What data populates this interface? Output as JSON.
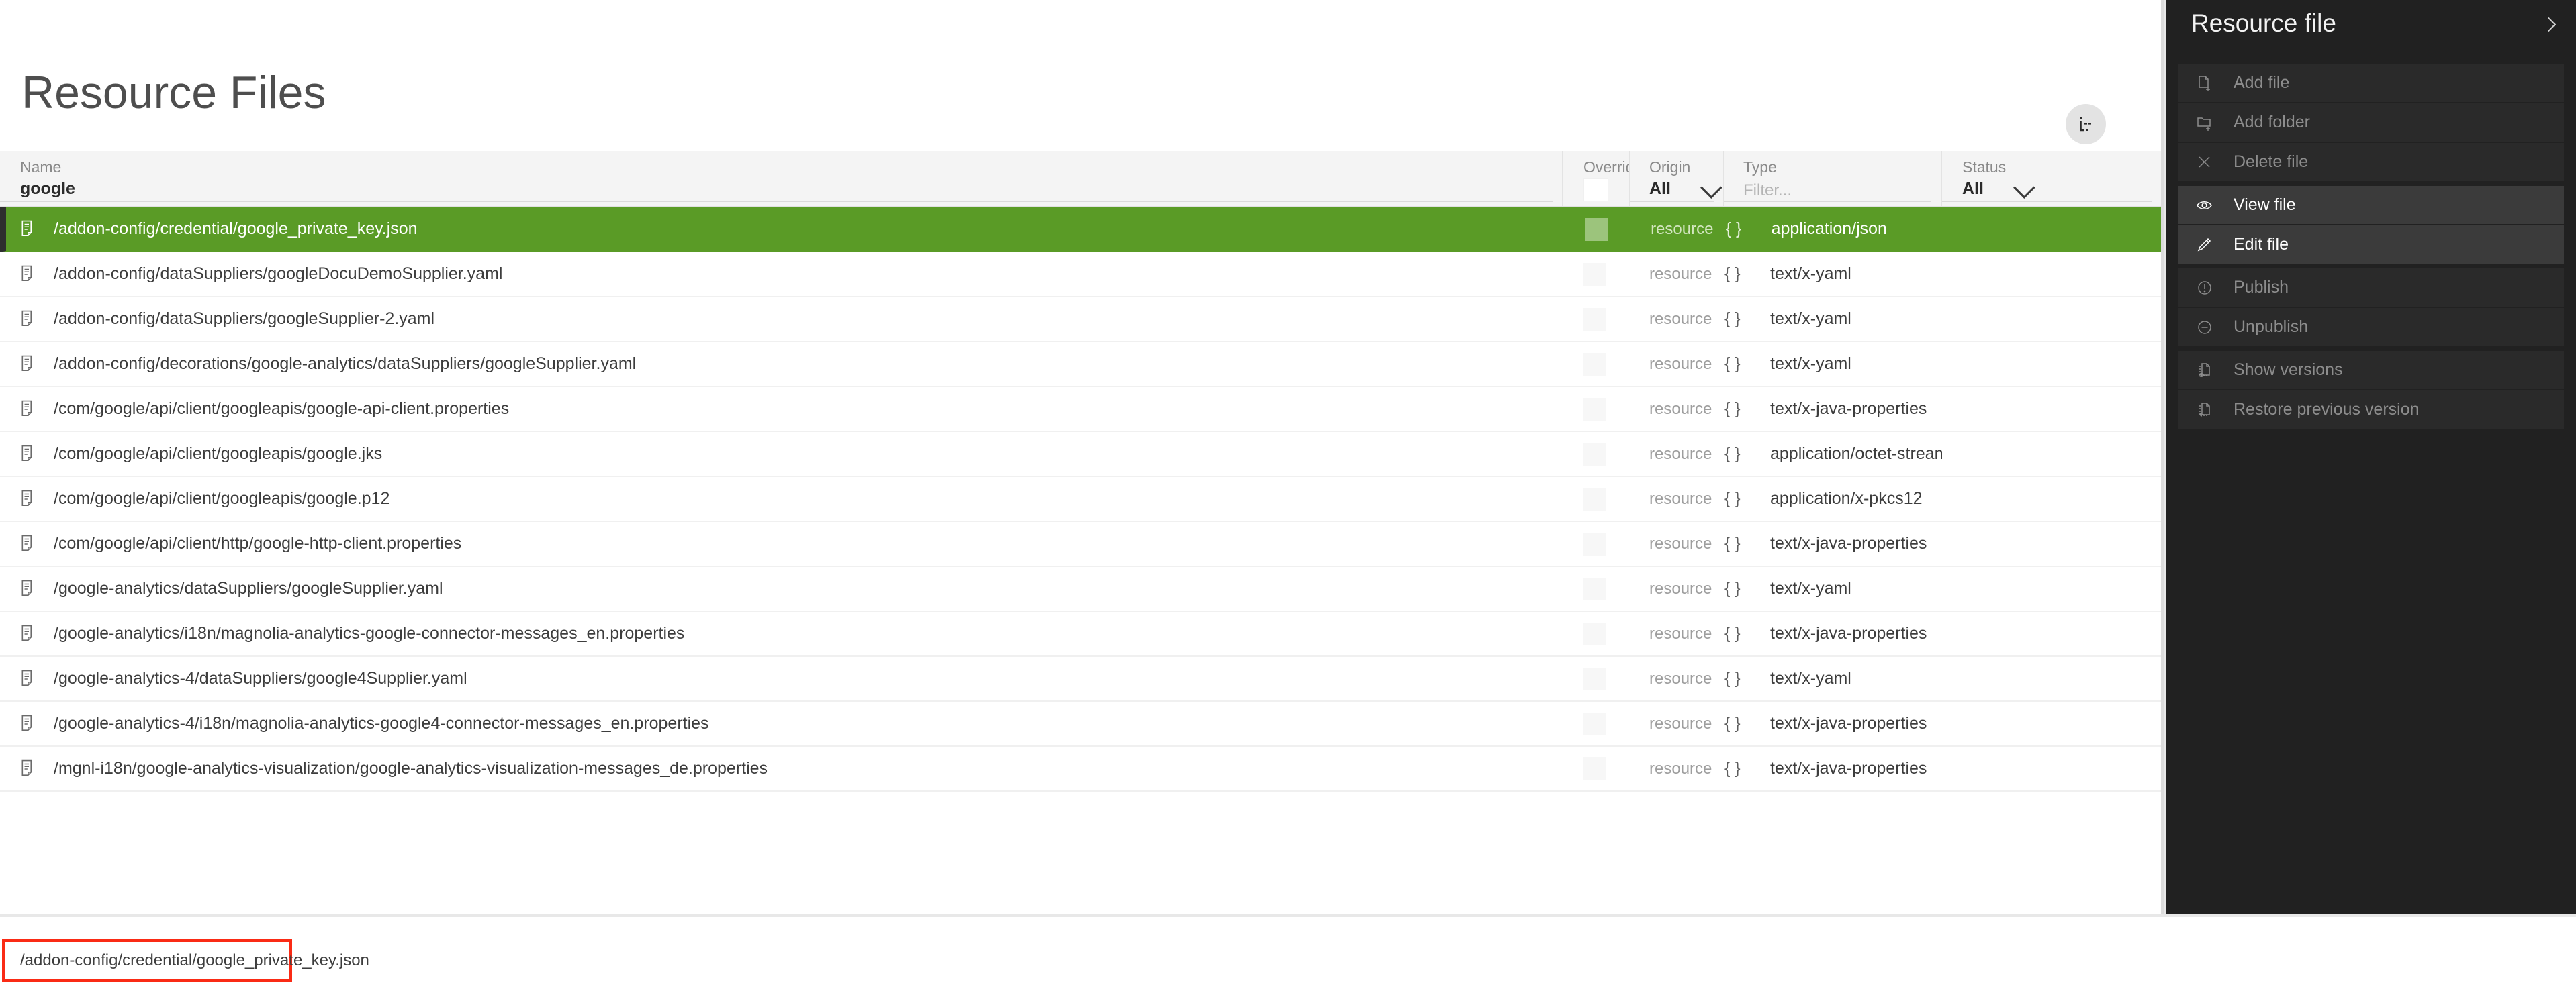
{
  "page": {
    "title": "Resource Files",
    "view_toggle_icon": "tree-view-icon"
  },
  "table": {
    "columns": [
      {
        "key": "name",
        "label": "Name",
        "filter_value": "google",
        "filter_type": "text"
      },
      {
        "key": "overrides",
        "label": "Overrides ?",
        "filter_value": "",
        "filter_type": "box"
      },
      {
        "key": "origin",
        "label": "Origin",
        "filter_value": "All",
        "filter_type": "select"
      },
      {
        "key": "type",
        "label": "Type",
        "filter_placeholder": "Filter...",
        "filter_type": "text-empty"
      },
      {
        "key": "status",
        "label": "Status",
        "filter_value": "All",
        "filter_type": "select"
      }
    ],
    "rows": [
      {
        "name": "/addon-config/credential/google_private_key.json",
        "origin": "resource",
        "braces": "{ }",
        "type": "application/json",
        "selected": true
      },
      {
        "name": "/addon-config/dataSuppliers/googleDocuDemoSupplier.yaml",
        "origin": "resource",
        "braces": "{ }",
        "type": "text/x-yaml",
        "selected": false
      },
      {
        "name": "/addon-config/dataSuppliers/googleSupplier-2.yaml",
        "origin": "resource",
        "braces": "{ }",
        "type": "text/x-yaml",
        "selected": false
      },
      {
        "name": "/addon-config/decorations/google-analytics/dataSuppliers/googleSupplier.yaml",
        "origin": "resource",
        "braces": "{ }",
        "type": "text/x-yaml",
        "selected": false
      },
      {
        "name": "/com/google/api/client/googleapis/google-api-client.properties",
        "origin": "resource",
        "braces": "{ }",
        "type": "text/x-java-properties",
        "selected": false
      },
      {
        "name": "/com/google/api/client/googleapis/google.jks",
        "origin": "resource",
        "braces": "{ }",
        "type": "application/octet-stream",
        "selected": false
      },
      {
        "name": "/com/google/api/client/googleapis/google.p12",
        "origin": "resource",
        "braces": "{ }",
        "type": "application/x-pkcs12",
        "selected": false
      },
      {
        "name": "/com/google/api/client/http/google-http-client.properties",
        "origin": "resource",
        "braces": "{ }",
        "type": "text/x-java-properties",
        "selected": false
      },
      {
        "name": "/google-analytics/dataSuppliers/googleSupplier.yaml",
        "origin": "resource",
        "braces": "{ }",
        "type": "text/x-yaml",
        "selected": false
      },
      {
        "name": "/google-analytics/i18n/magnolia-analytics-google-connector-messages_en.properties",
        "origin": "resource",
        "braces": "{ }",
        "type": "text/x-java-properties",
        "selected": false
      },
      {
        "name": "/google-analytics-4/dataSuppliers/google4Supplier.yaml",
        "origin": "resource",
        "braces": "{ }",
        "type": "text/x-yaml",
        "selected": false
      },
      {
        "name": "/google-analytics-4/i18n/magnolia-analytics-google4-connector-messages_en.properties",
        "origin": "resource",
        "braces": "{ }",
        "type": "text/x-java-properties",
        "selected": false
      },
      {
        "name": "/mgnl-i18n/google-analytics-visualization/google-analytics-visualization-messages_de.properties",
        "origin": "resource",
        "braces": "{ }",
        "type": "text/x-java-properties",
        "selected": false
      }
    ]
  },
  "side_panel": {
    "title": "Resource file",
    "collapse_icon": "chevron-right-icon",
    "groups": [
      {
        "items": [
          {
            "label": "Add file",
            "icon": "add-file-icon",
            "active": false
          },
          {
            "label": "Add folder",
            "icon": "add-folder-icon",
            "active": false
          },
          {
            "label": "Delete file",
            "icon": "close-x-icon",
            "active": false
          }
        ]
      },
      {
        "items": [
          {
            "label": "View file",
            "icon": "eye-icon",
            "active": true
          },
          {
            "label": "Edit file",
            "icon": "pencil-icon",
            "active": true
          }
        ]
      },
      {
        "items": [
          {
            "label": "Publish",
            "icon": "exclamation-circle-icon",
            "active": false
          },
          {
            "label": "Unpublish",
            "icon": "minus-circle-icon",
            "active": false
          }
        ]
      },
      {
        "items": [
          {
            "label": "Show versions",
            "icon": "versions-eye-icon",
            "active": false
          },
          {
            "label": "Restore previous version",
            "icon": "versions-restore-icon",
            "active": false
          }
        ]
      }
    ]
  },
  "path_highlight": {
    "text": "/addon-config/credential/google_private_key.json",
    "border_color": "#fa2b15"
  },
  "colors": {
    "selection_green": "#5a9b26",
    "panel_dark": "#212121",
    "header_gray": "#f4f4f4",
    "highlight_red": "#fa2b15"
  }
}
